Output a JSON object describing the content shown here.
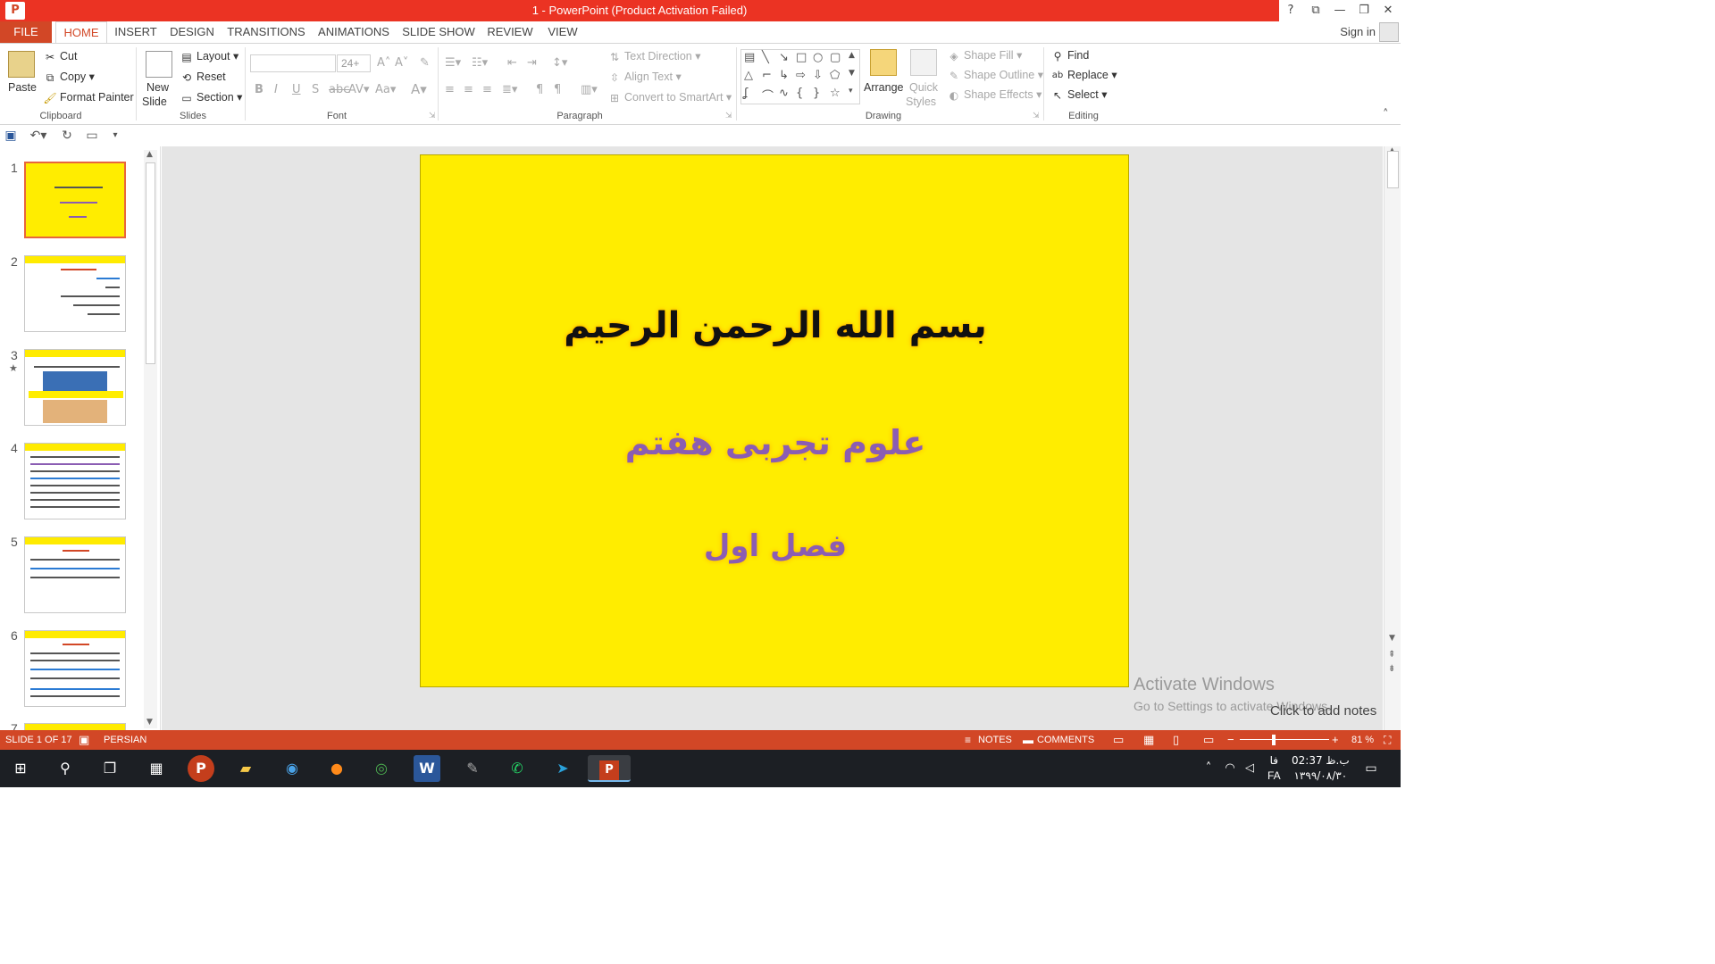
{
  "app": {
    "window_title": "1 -  PowerPoint (Product Activation Failed)",
    "window_buttons": {
      "help": "?",
      "ribbon_display": "⧉",
      "minimize": "—",
      "restore": "❐",
      "close": "✕"
    }
  },
  "tabs": [
    "FILE",
    "HOME",
    "INSERT",
    "DESIGN",
    "TRANSITIONS",
    "ANIMATIONS",
    "SLIDE SHOW",
    "REVIEW",
    "VIEW"
  ],
  "account": {
    "signin": "Sign in"
  },
  "ribbon": {
    "clipboard": {
      "paste": "Paste",
      "cut": "Cut",
      "copy": "Copy",
      "format_painter": "Format Painter",
      "label": "Clipboard"
    },
    "slides": {
      "new_slide": "New",
      "new_slide2": "Slide",
      "layout": "Layout",
      "reset": "Reset",
      "section": "Section",
      "label": "Slides"
    },
    "font": {
      "font_name": "",
      "font_size": "24+",
      "label": "Font"
    },
    "paragraph": {
      "text_direction": "Text Direction",
      "align_text": "Align Text",
      "convert_smartart": "Convert to SmartArt",
      "label": "Paragraph"
    },
    "drawing": {
      "arrange": "Arrange",
      "quick_styles": "Quick",
      "quick_styles2": "Styles",
      "shape_fill": "Shape Fill",
      "shape_outline": "Shape Outline",
      "shape_effects": "Shape Effects",
      "label": "Drawing"
    },
    "editing": {
      "find": "Find",
      "replace": "Replace",
      "select": "Select",
      "label": "Editing"
    }
  },
  "thumbnails": [
    {
      "num": "1"
    },
    {
      "num": "2"
    },
    {
      "num": "3"
    },
    {
      "num": "4"
    },
    {
      "num": "5"
    },
    {
      "num": "6"
    },
    {
      "num": "7"
    }
  ],
  "slide": {
    "title": "بسم الله الرحمن الرحیم",
    "subtitle": "علوم تجربی هفتم",
    "chapter": "فصل اول",
    "bg_color": "#ffed00"
  },
  "editor": {
    "notes_hint": "Click to add notes",
    "activate_title": "Activate Windows",
    "activate_sub": "Go to Settings to activate Windows."
  },
  "status": {
    "slide_counter": "SLIDE 1 OF 17",
    "language": "PERSIAN",
    "notes": "NOTES",
    "comments": "COMMENTS",
    "zoom": "81 %",
    "accent": "#d24726"
  },
  "taskbar": {
    "lang": "FA",
    "lang_fa": "فا",
    "time": "02:37 ب.ظ",
    "date": "۱۳۹۹/۰۸/۳۰"
  }
}
